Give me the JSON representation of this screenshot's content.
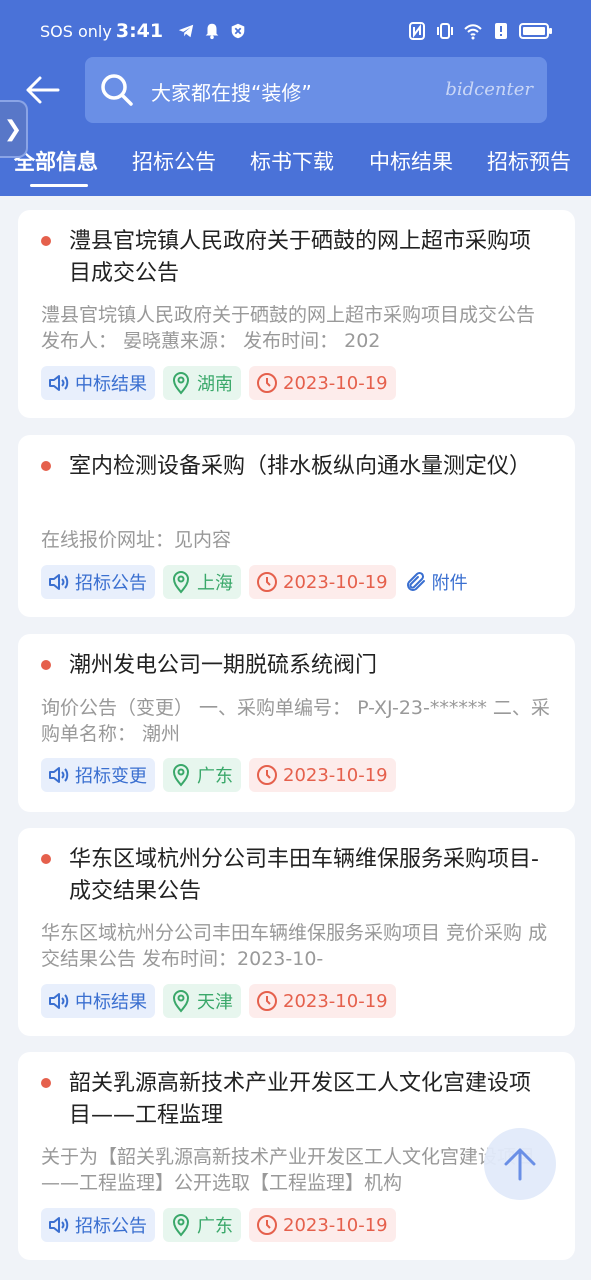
{
  "status_bar": {
    "network": "SOS only",
    "time": "3:41"
  },
  "search": {
    "placeholder": "大家都在搜“装修”",
    "brand": "bidcenter"
  },
  "tabs": [
    {
      "label": "全部信息",
      "active": true
    },
    {
      "label": "招标公告",
      "active": false
    },
    {
      "label": "标书下载",
      "active": false
    },
    {
      "label": "中标结果",
      "active": false
    },
    {
      "label": "招标预告",
      "active": false
    }
  ],
  "items": [
    {
      "title": "澧县官垸镇人民政府关于硒鼓的网上超市采购项目成交公告",
      "desc": "澧县官垸镇人民政府关于硒鼓的网上超市采购项目成交公告 发布人： 晏晓蕙来源： 发布时间： 202",
      "type": "中标结果",
      "region": "湖南",
      "date": "2023-10-19"
    },
    {
      "title": "室内检测设备采购（排水板纵向通水量测定仪）",
      "desc": "在线报价网址：见内容",
      "type": "招标公告",
      "region": "上海",
      "date": "2023-10-19",
      "attachment": "附件"
    },
    {
      "title": "潮州发电公司一期脱硫系统阀门",
      "desc": "询价公告（变更） 一、采购单编号： P-XJ-23-****** 二、采购单名称： 潮州",
      "type": "招标变更",
      "region": "广东",
      "date": "2023-10-19"
    },
    {
      "title": "华东区域杭州分公司丰田车辆维保服务采购项目-成交结果公告",
      "desc": "华东区域杭州分公司丰田车辆维保服务采购项目 竞价采购 成交结果公告 发布时间：2023-10-",
      "type": "中标结果",
      "region": "天津",
      "date": "2023-10-19"
    },
    {
      "title": "韶关乳源高新技术产业开发区工人文化宫建设项目——工程监理",
      "desc": "关于为【韶关乳源高新技术产业开发区工人文化宫建设项目——工程监理】公开选取【工程监理】机构",
      "type": "招标公告",
      "region": "广东",
      "date": "2023-10-19"
    }
  ],
  "colors": {
    "header": "#4a72d8",
    "type_tag": "#3a6fd0",
    "region_tag": "#3aa86a",
    "date_tag": "#e5604c"
  }
}
